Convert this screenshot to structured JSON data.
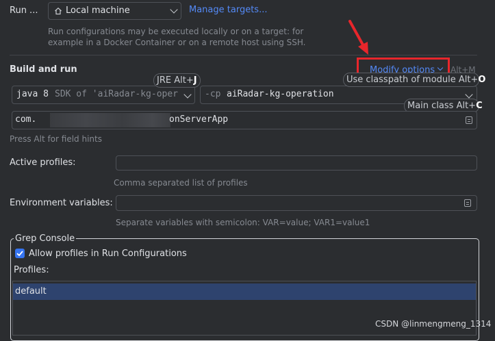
{
  "run_on": {
    "label": "Run ...",
    "selected": "Local machine",
    "manage_link": "Manage targets...",
    "description_line1": "Run configurations may be executed locally or on a target: for",
    "description_line2": "example in a Docker Container or on a remote host using SSH."
  },
  "build_run": {
    "title": "Build and run",
    "modify_options": "Modify options",
    "modify_shortcut": "Alt+M",
    "jre_hint_text": "JRE Alt+",
    "jre_hint_key": "J",
    "classpath_hint_text": "Use classpath of module Alt+",
    "classpath_hint_key": "O",
    "main_class_hint_text": "Main class Alt+",
    "main_class_hint_key": "C",
    "jre_java": "java 8",
    "jre_sdk": "SDK of 'aiRadar-kg-oper",
    "cp_prefix": "-cp",
    "cp_module": "aiRadar-kg-operation",
    "main_class_prefix": "com.",
    "main_class_suffix": "onServerApp",
    "field_hints": "Press Alt for field hints"
  },
  "profiles": {
    "label": "Active profiles:",
    "value": "",
    "help": "Comma separated list of profiles"
  },
  "env": {
    "label": "Environment variables:",
    "value": "",
    "help": "Separate variables with semicolon: VAR=value; VAR1=value1"
  },
  "grep_console": {
    "title": "Grep Console",
    "allow_label": "Allow profiles in Run Configurations",
    "allow_checked": true,
    "profiles_label": "Profiles:",
    "items": [
      "default"
    ]
  },
  "watermark": "CSDN @linmengmeng_1314",
  "colors": {
    "background": "#2b2d30",
    "link": "#548af7",
    "selection": "#2e436e",
    "annotation_red": "#e8262b",
    "checkbox": "#3574f0"
  }
}
